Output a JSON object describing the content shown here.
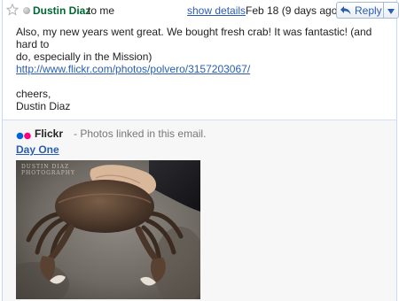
{
  "header": {
    "sender": "Dustin Diaz",
    "recipient": "to me",
    "show_details": "show details",
    "date": "Feb 18 (9 days ago)",
    "reply_label": "Reply"
  },
  "message": {
    "line1": "Also, my new years went great. We bought fresh crab! It was fantastic! (and hard to",
    "line2": "do, especially in the Mission)",
    "link": "http://www.flickr.com/photos/polvero/3157203067/",
    "signoff": "cheers,",
    "signature": "Dustin Diaz"
  },
  "flickr": {
    "title": "Flickr",
    "description": "- Photos linked in this email.",
    "photo_title": "Day One",
    "watermark_line1": "DUSTIN DIAZ",
    "watermark_line2": "PHOTOGRAPHY"
  },
  "colors": {
    "sender_green": "#006633",
    "link_blue": "#2a5db0",
    "flickr_blue": "#0063dc",
    "flickr_pink": "#ff0084"
  },
  "icons": {
    "star": "star-icon",
    "presence": "presence-dot-icon",
    "reply": "reply-arrow-icon",
    "dropdown": "dropdown-triangle-icon",
    "flickr": "flickr-logo-icon"
  }
}
